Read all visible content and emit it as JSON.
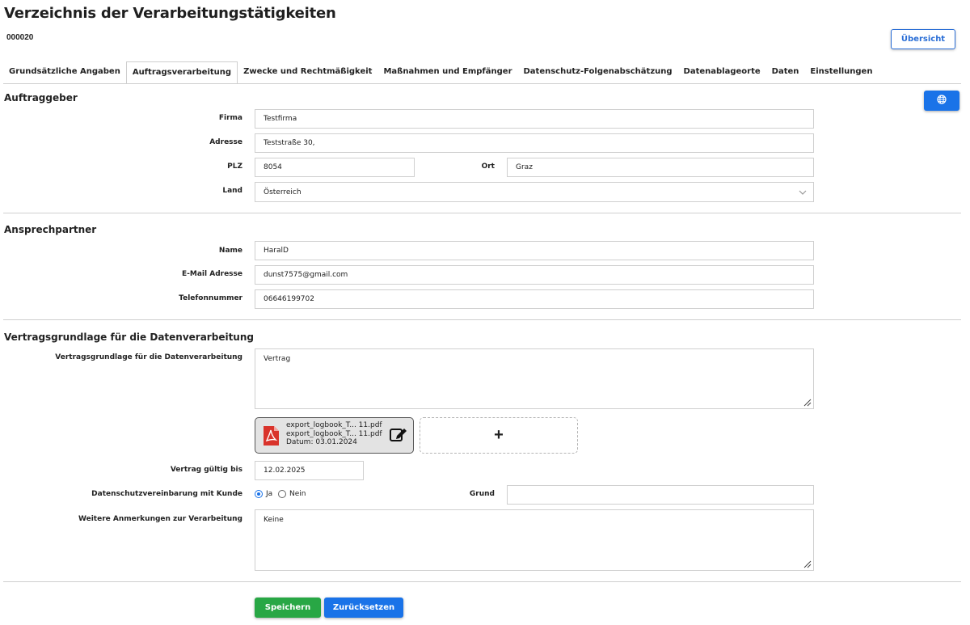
{
  "header": {
    "title": "Verzeichnis der Verarbeitungstätigkeiten",
    "record_number": "000020",
    "overview_button": "Übersicht"
  },
  "tabs": [
    {
      "label": "Grundsätzliche Angaben",
      "active": false
    },
    {
      "label": "Auftragsverarbeitung",
      "active": true
    },
    {
      "label": "Zwecke und Rechtmäßigkeit",
      "active": false
    },
    {
      "label": "Maßnahmen und Empfänger",
      "active": false
    },
    {
      "label": "Datenschutz-Folgenabschätzung",
      "active": false
    },
    {
      "label": "Datenablageorte",
      "active": false
    },
    {
      "label": "Daten",
      "active": false
    },
    {
      "label": "Einstellungen",
      "active": false
    }
  ],
  "auftraggeber": {
    "title": "Auftraggeber",
    "firma_label": "Firma",
    "firma_value": "Testfirma",
    "adresse_label": "Adresse",
    "adresse_value": "Teststraße 30,",
    "plz_label": "PLZ",
    "plz_value": "8054",
    "ort_label": "Ort",
    "ort_value": "Graz",
    "land_label": "Land",
    "land_value": "Österreich"
  },
  "ansprechpartner": {
    "title": "Ansprechpartner",
    "name_label": "Name",
    "name_value": "HaralD",
    "email_label": "E-Mail Adresse",
    "email_value": "dunst7575@gmail.com",
    "telefon_label": "Telefonnummer",
    "telefon_value": "06646199702"
  },
  "vertrag": {
    "title": "Vertragsgrundlage für die Datenverarbeitung",
    "grundlage_label": "Vertragsgrundlage für die Datenverarbeitung",
    "grundlage_value": "Vertrag",
    "file": {
      "line1": "export_logbook_T... 11.pdf",
      "line2": "export_logbook_T... 11.pdf",
      "date": "Datum: 03.01.2024"
    },
    "add_symbol": "+",
    "gueltig_label": "Vertrag gültig bis",
    "gueltig_value": "12.02.2025",
    "dsv_label": "Datenschutzvereinbarung mit Kunde",
    "ja_label": "Ja",
    "nein_label": "Nein",
    "selected": "Ja",
    "grund_label": "Grund",
    "grund_value": "",
    "anmerkungen_label": "Weitere Anmerkungen zur Verarbeitung",
    "anmerkungen_value": "Keine"
  },
  "actions": {
    "save": "Speichern",
    "reset": "Zurücksetzen"
  },
  "colors": {
    "primary": "#1a73e8",
    "success": "#28a745",
    "pdf_red": "#d9332b",
    "border": "#cfcfcf"
  },
  "icons": [
    "globe-icon",
    "pdf-icon",
    "edit-icon",
    "chevron-down-icon",
    "resize-handle-icon"
  ]
}
